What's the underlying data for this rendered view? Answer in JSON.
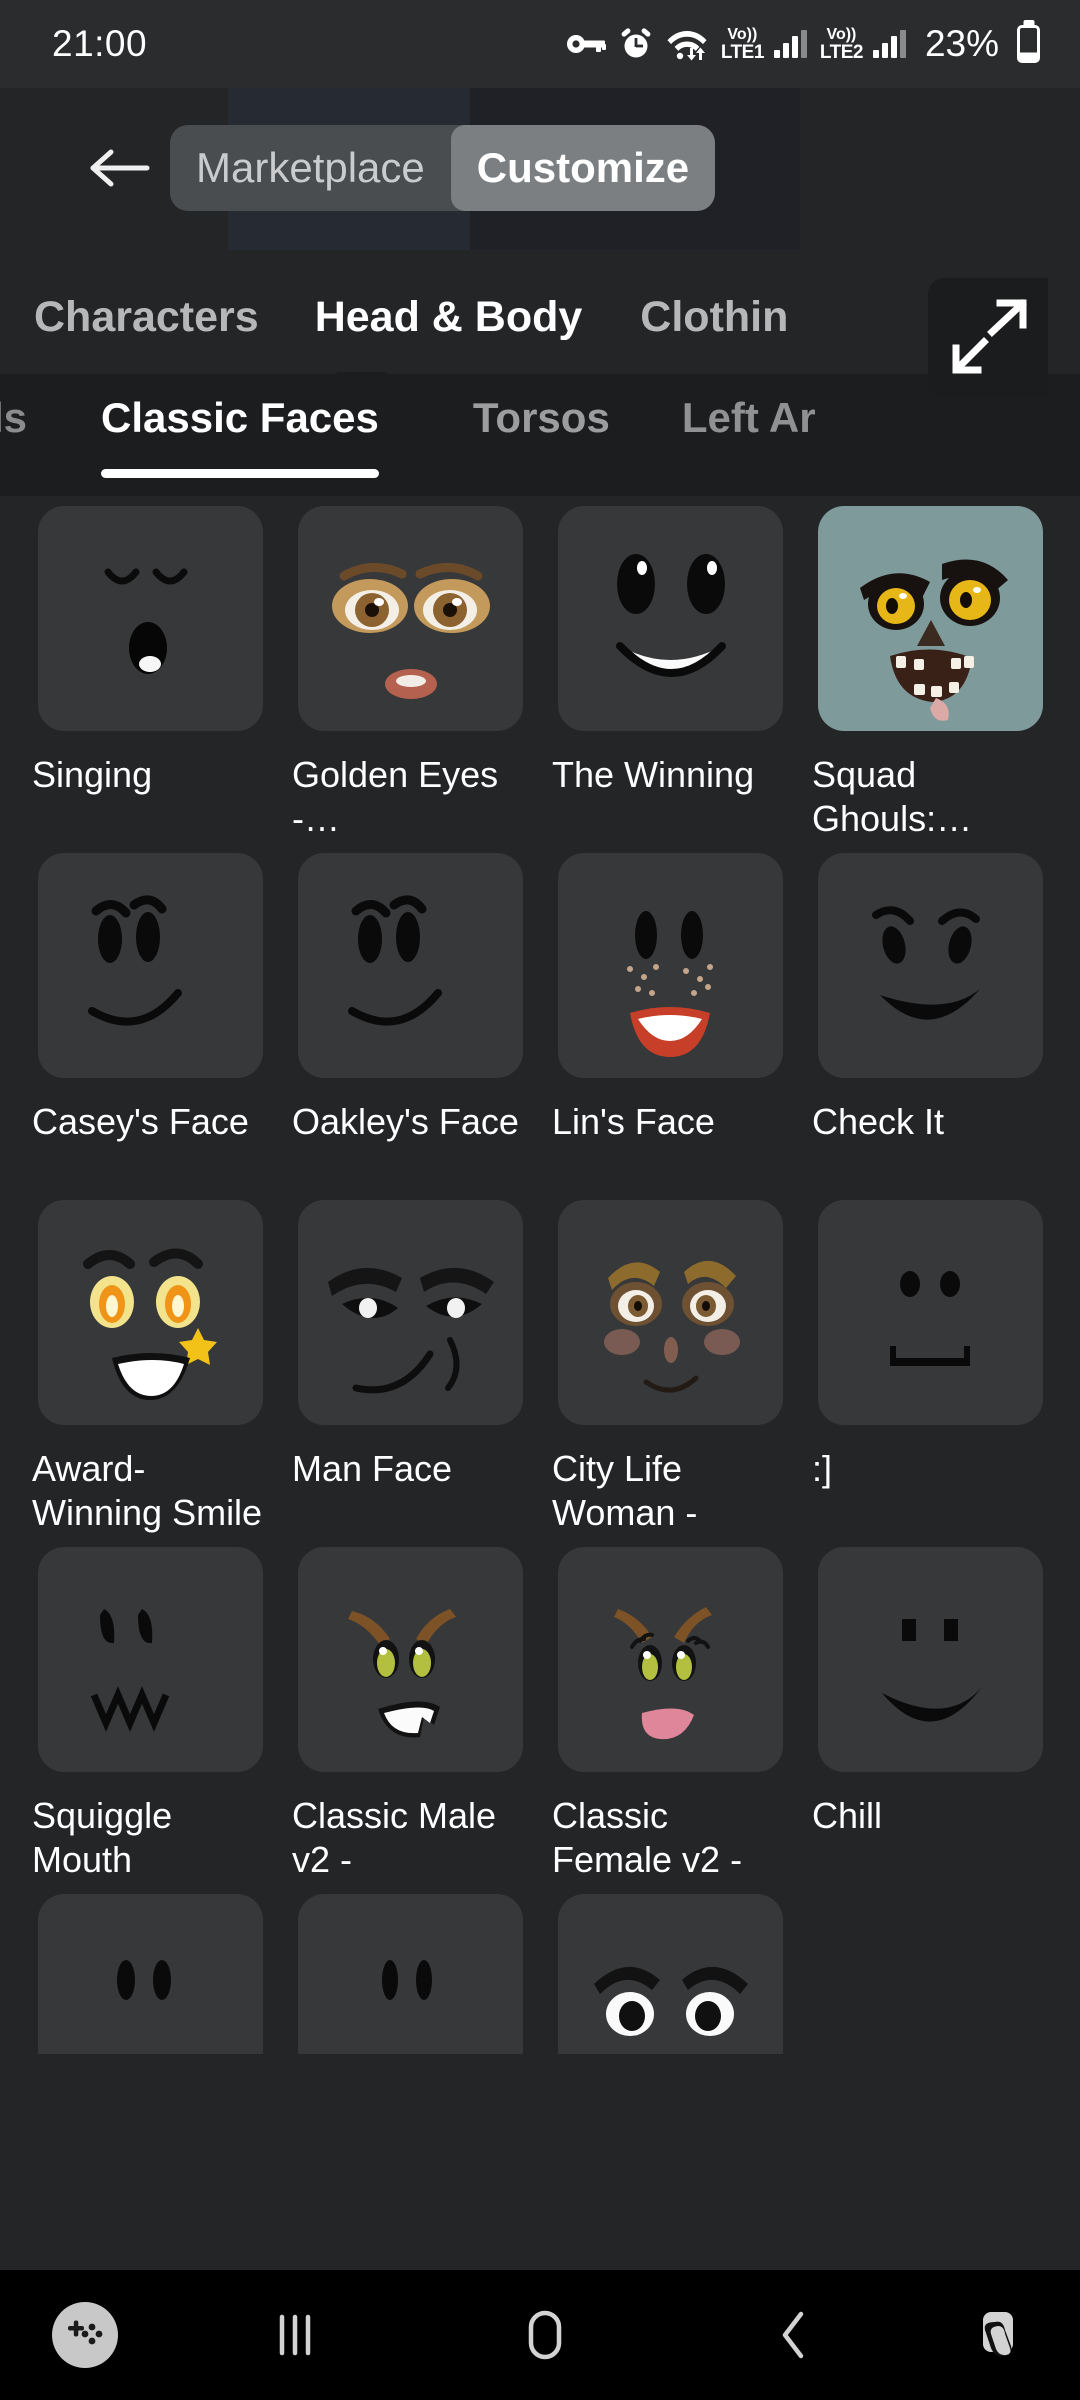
{
  "statusbar": {
    "time": "21:00",
    "battery_percent": "23%",
    "icons": [
      "key-icon",
      "alarm-icon",
      "wifi-icon"
    ],
    "sims": [
      {
        "volte_top": "Vo))",
        "volte_bottom": "LTE1"
      },
      {
        "volte_top": "Vo))",
        "volte_bottom": "LTE2"
      }
    ]
  },
  "header": {
    "back_icon": "arrow-left-icon",
    "segments": [
      {
        "label": "Marketplace",
        "active": false
      },
      {
        "label": "Customize",
        "active": true
      }
    ]
  },
  "category_tabs": [
    {
      "label": "Characters",
      "active": false
    },
    {
      "label": "Head & Body",
      "active": true
    },
    {
      "label": "Clothin",
      "active": false
    }
  ],
  "resize_button": {
    "icon": "expand-diagonal-icon"
  },
  "sub_tabs": [
    {
      "label": "ds",
      "active": false
    },
    {
      "label": "Classic Faces",
      "active": true
    },
    {
      "label": "Torsos",
      "active": false
    },
    {
      "label": "Left Ar",
      "active": false
    }
  ],
  "items": [
    {
      "name": "Singing",
      "art": "singing",
      "selected": false
    },
    {
      "name": "Golden Eyes -…",
      "art": "golden-eyes",
      "selected": false
    },
    {
      "name": "The Winning",
      "art": "the-winning",
      "selected": false
    },
    {
      "name": "Squad Ghouls:…",
      "art": "squad-ghouls",
      "selected": true
    },
    {
      "name": "Casey's Face",
      "art": "caseys-face",
      "selected": false
    },
    {
      "name": "Oakley's Face",
      "art": "oakleys-face",
      "selected": false
    },
    {
      "name": "Lin's Face",
      "art": "lins-face",
      "selected": false
    },
    {
      "name": "Check It",
      "art": "check-it",
      "selected": false
    },
    {
      "name": "Award-Winning Smile",
      "art": "award-winning-smile",
      "selected": false
    },
    {
      "name": "Man Face",
      "art": "man-face",
      "selected": false
    },
    {
      "name": "City Life Woman -",
      "art": "city-life-woman",
      "selected": false
    },
    {
      "name": ":]",
      "art": "colon-bracket",
      "selected": false
    },
    {
      "name": "Squiggle Mouth",
      "art": "squiggle-mouth",
      "selected": false
    },
    {
      "name": "Classic Male v2 -",
      "art": "classic-male-v2",
      "selected": false
    },
    {
      "name": "Classic Female v2 -",
      "art": "classic-female-v2",
      "selected": false
    },
    {
      "name": "Chill",
      "art": "chill",
      "selected": false
    }
  ],
  "partial_items": [
    {
      "name": "",
      "art": "partial-dots-a"
    },
    {
      "name": "",
      "art": "partial-dots-b"
    },
    {
      "name": "",
      "art": "partial-eyes"
    }
  ],
  "navbar": {
    "items": [
      {
        "icon": "gamepad-icon",
        "label": ""
      },
      {
        "icon": "recents-icon",
        "label": ""
      },
      {
        "icon": "home-icon",
        "label": ""
      },
      {
        "icon": "back-icon",
        "label": ""
      },
      {
        "icon": "floating-pointer-icon",
        "label": ""
      }
    ]
  },
  "colors": {
    "background": "#232527",
    "subtab_bar": "#1b1d1f",
    "tile": "#36383a",
    "tile_selected": "#7e9a9b",
    "segment_active": "#7c7f82",
    "segment_track": "#4a4d50",
    "text_primary": "#ffffff",
    "text_muted": "#b5b7b9",
    "navbar": "#000000"
  }
}
